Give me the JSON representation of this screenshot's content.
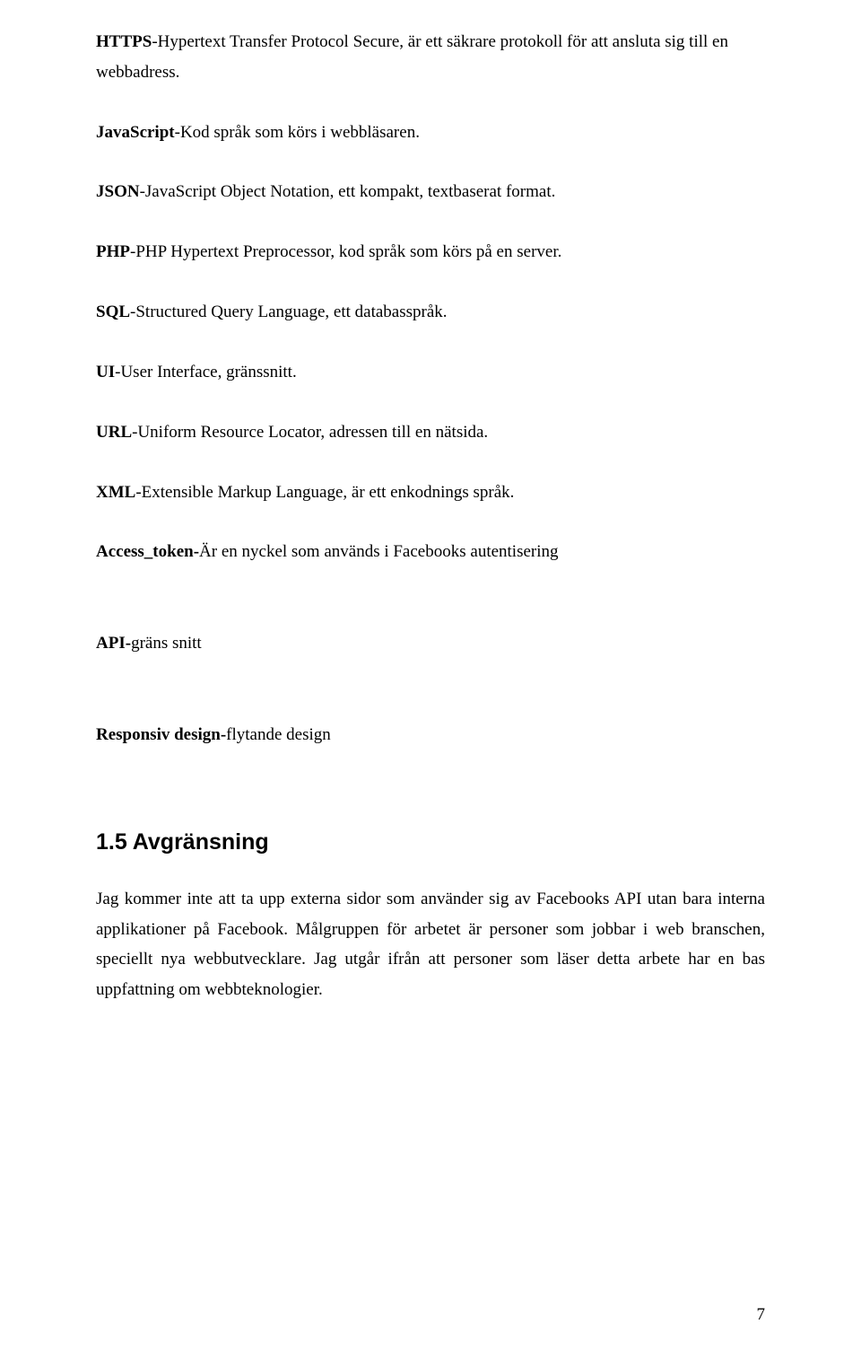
{
  "definitions": [
    {
      "term": "HTTPS",
      "sep": "-",
      "desc": "Hypertext Transfer Protocol Secure, är ett säkrare protokoll för att ansluta sig till en webbadress.",
      "bigGap": false
    },
    {
      "term": "JavaScript",
      "sep": "-",
      "desc": "Kod språk som körs i webbläsaren.",
      "bigGap": false
    },
    {
      "term": "JSON",
      "sep": "-",
      "desc": "JavaScript Object Notation, ett kompakt, textbaserat format.",
      "bigGap": false
    },
    {
      "term": "PHP",
      "sep": "-",
      "desc": "PHP Hypertext Preprocessor, kod språk som körs på en server.",
      "bigGap": false
    },
    {
      "term": "SQL",
      "sep": "-",
      "desc": "Structured Query Language, ett databasspråk.",
      "bigGap": false
    },
    {
      "term": "UI",
      "sep": "-",
      "desc": "User Interface, gränssnitt.",
      "bigGap": false
    },
    {
      "term": "URL",
      "sep": "-",
      "desc": "Uniform Resource Locator, adressen till en nätsida.",
      "bigGap": false
    },
    {
      "term": "XML",
      "sep": "-",
      "desc": "Extensible Markup Language, är ett enkodnings språk.",
      "bigGap": false
    },
    {
      "term": "Access_token-",
      "sep": "",
      "desc": "Är en nyckel som används i Facebooks autentisering",
      "bigGap": true
    },
    {
      "term": "API-",
      "sep": "",
      "desc": "gräns snitt",
      "bigGap": true
    },
    {
      "term": "Responsiv design-",
      "sep": "",
      "desc": "flytande design",
      "bigGap": false
    }
  ],
  "section": {
    "heading": "1.5 Avgränsning",
    "body": "Jag kommer inte att ta upp externa sidor som använder sig av Facebooks API utan bara interna applikationer på Facebook. Målgruppen för arbetet är personer som jobbar i web branschen, speciellt nya webbutvecklare. Jag utgår ifrån att personer som läser detta arbete har en bas uppfattning om webbteknologier."
  },
  "pageNumber": "7"
}
